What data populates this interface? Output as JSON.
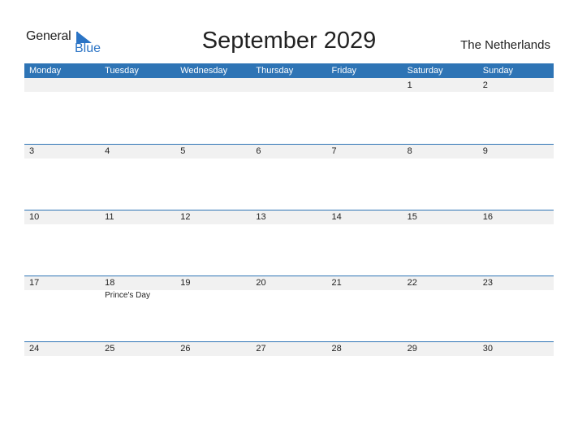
{
  "logo": {
    "text_top": "General",
    "text_bottom": "Blue",
    "accent": "#2b74c5"
  },
  "title": "September 2029",
  "country": "The Netherlands",
  "header_color": "#2e74b5",
  "weekdays": [
    "Monday",
    "Tuesday",
    "Wednesday",
    "Thursday",
    "Friday",
    "Saturday",
    "Sunday"
  ],
  "weeks": [
    {
      "days": [
        {
          "num": "",
          "event": ""
        },
        {
          "num": "",
          "event": ""
        },
        {
          "num": "",
          "event": ""
        },
        {
          "num": "",
          "event": ""
        },
        {
          "num": "",
          "event": ""
        },
        {
          "num": "1",
          "event": ""
        },
        {
          "num": "2",
          "event": ""
        }
      ]
    },
    {
      "days": [
        {
          "num": "3",
          "event": ""
        },
        {
          "num": "4",
          "event": ""
        },
        {
          "num": "5",
          "event": ""
        },
        {
          "num": "6",
          "event": ""
        },
        {
          "num": "7",
          "event": ""
        },
        {
          "num": "8",
          "event": ""
        },
        {
          "num": "9",
          "event": ""
        }
      ]
    },
    {
      "days": [
        {
          "num": "10",
          "event": ""
        },
        {
          "num": "11",
          "event": ""
        },
        {
          "num": "12",
          "event": ""
        },
        {
          "num": "13",
          "event": ""
        },
        {
          "num": "14",
          "event": ""
        },
        {
          "num": "15",
          "event": ""
        },
        {
          "num": "16",
          "event": ""
        }
      ]
    },
    {
      "days": [
        {
          "num": "17",
          "event": ""
        },
        {
          "num": "18",
          "event": "Prince's Day"
        },
        {
          "num": "19",
          "event": ""
        },
        {
          "num": "20",
          "event": ""
        },
        {
          "num": "21",
          "event": ""
        },
        {
          "num": "22",
          "event": ""
        },
        {
          "num": "23",
          "event": ""
        }
      ]
    },
    {
      "days": [
        {
          "num": "24",
          "event": ""
        },
        {
          "num": "25",
          "event": ""
        },
        {
          "num": "26",
          "event": ""
        },
        {
          "num": "27",
          "event": ""
        },
        {
          "num": "28",
          "event": ""
        },
        {
          "num": "29",
          "event": ""
        },
        {
          "num": "30",
          "event": ""
        }
      ]
    }
  ]
}
